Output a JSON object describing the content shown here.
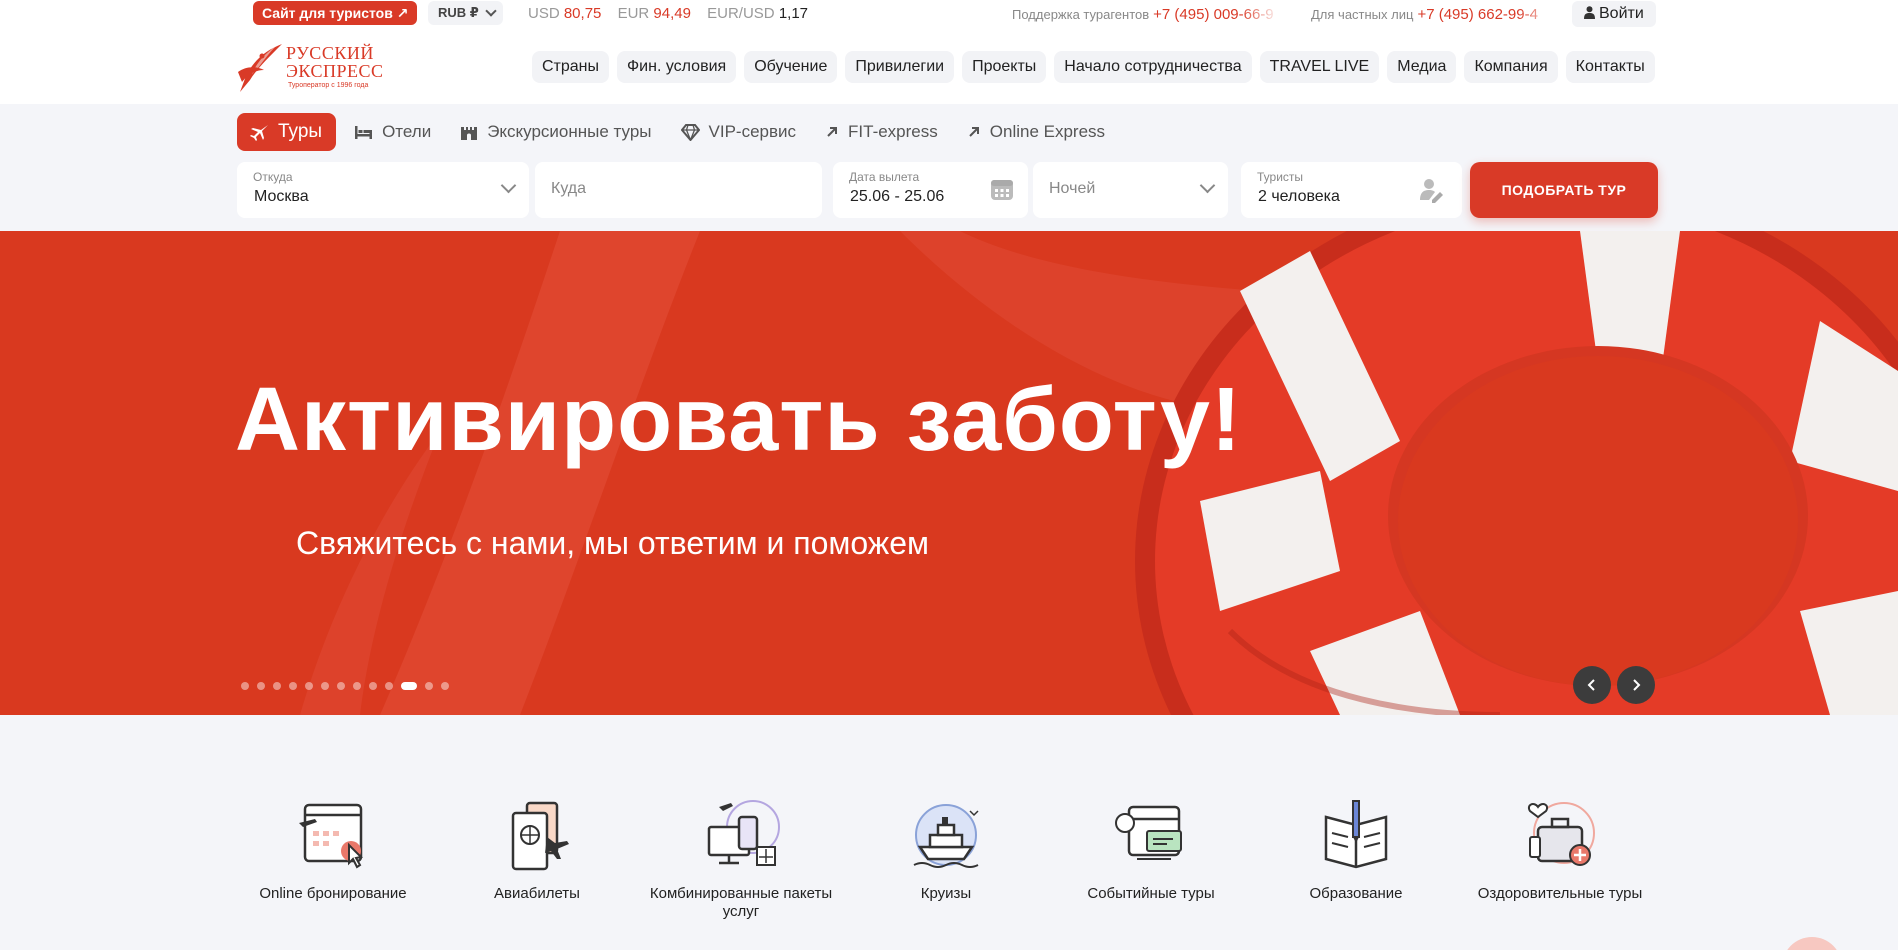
{
  "topbar": {
    "tourist_site": "Сайт для туристов ↗",
    "currency": "RUB ₽",
    "rates": [
      {
        "label": "USD",
        "value": "80,75"
      },
      {
        "label": "EUR",
        "value": "94,49"
      },
      {
        "label": "EUR/USD",
        "value": "1,17"
      }
    ],
    "support_label": "Поддержка турагентов",
    "support_phone": "+7 (495) 009-66-9",
    "private_label": "Для частных лиц",
    "private_phone": "+7 (495) 662-99-4",
    "login": "Войти"
  },
  "logo": {
    "line1": "РУССКИЙ",
    "line2": "ЭКСПРЕСС",
    "tagline": "Туроператор с 1996 года"
  },
  "nav": [
    "Страны",
    "Фин. условия",
    "Обучение",
    "Привилегии",
    "Проекты",
    "Начало сотрудничества",
    "TRAVEL LIVE",
    "Медиа",
    "Компания",
    "Контакты"
  ],
  "search": {
    "tabs": [
      {
        "label": "Туры",
        "icon": "plane-icon",
        "active": true
      },
      {
        "label": "Отели",
        "icon": "bed-icon"
      },
      {
        "label": "Экскурсионные туры",
        "icon": "castle-icon"
      },
      {
        "label": "VIP-сервис",
        "icon": "diamond-icon"
      },
      {
        "label": "FIT-express",
        "icon": "arrow-up-right-icon"
      },
      {
        "label": "Online Express",
        "icon": "arrow-up-right-icon"
      }
    ],
    "from_label": "Откуда",
    "from_value": "Москва",
    "to_placeholder": "Куда",
    "date_label": "Дата вылета",
    "date_value": "25.06 - 25.06",
    "nights_placeholder": "Ночей",
    "tourists_label": "Туристы",
    "tourists_value": "2 человека",
    "submit": "ПОДОБРАТЬ ТУР"
  },
  "hero": {
    "title": "Активировать заботу!",
    "subtitle": "Свяжитесь с нами, мы ответим и поможем",
    "slides_total": 13,
    "active_slide": 11
  },
  "categories": [
    {
      "label": "Online бронирование",
      "icon": "online-booking-icon"
    },
    {
      "label": "Авиабилеты",
      "icon": "air-tickets-icon"
    },
    {
      "label": "Комбинированные пакеты услуг",
      "icon": "combined-packages-icon"
    },
    {
      "label": "Круизы",
      "icon": "cruise-ship-icon"
    },
    {
      "label": "Событийные туры",
      "icon": "event-calendar-icon"
    },
    {
      "label": "Образование",
      "icon": "education-book-icon"
    },
    {
      "label": "Оздоровительные туры",
      "icon": "wellness-suitcase-icon"
    }
  ],
  "colors": {
    "brand": "#d93a27",
    "hero_bg": "#d9391f",
    "page_bg": "#f4f5f9"
  }
}
